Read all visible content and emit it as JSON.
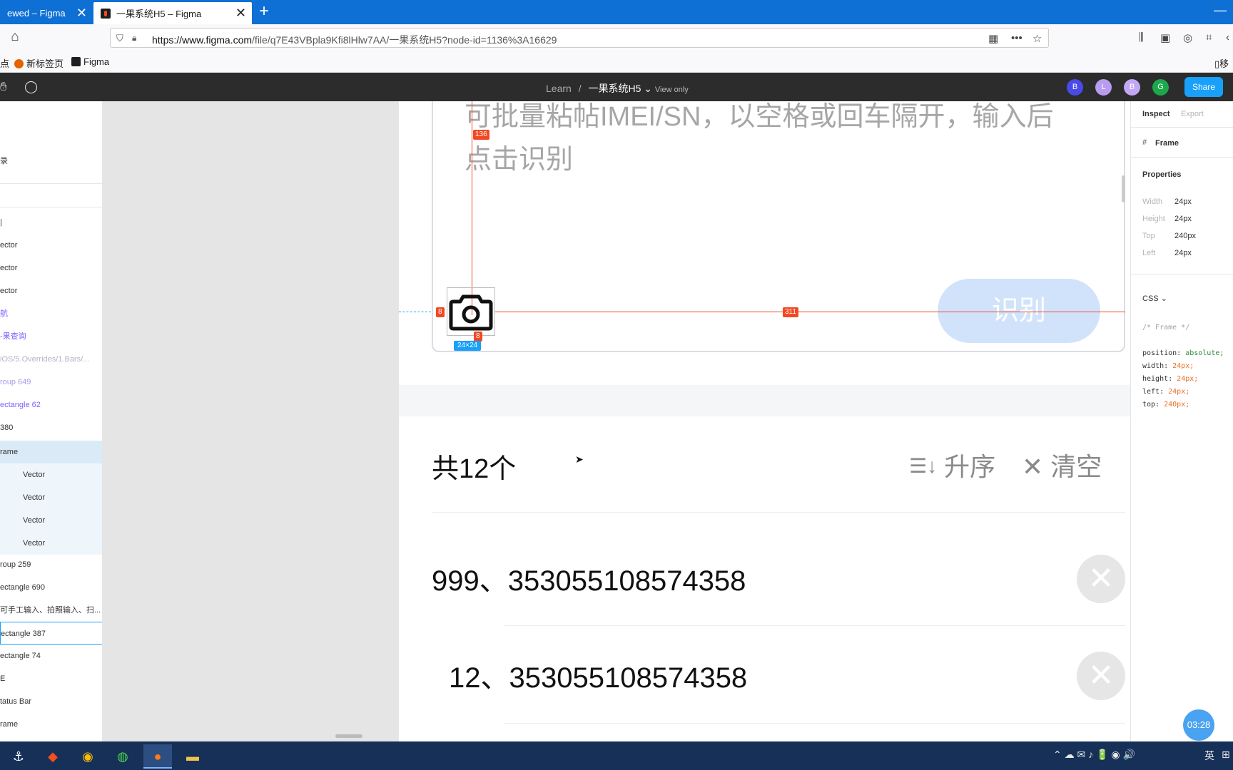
{
  "browser": {
    "tab_inactive": "ewed – Figma",
    "tab_active": "一果系统H5 – Figma",
    "tab_close": "✕",
    "new_tab": "+",
    "minimize": "—",
    "url_host": "https://www.figma.com",
    "url_path": "/file/q7E43VBpla9Kfi8lHlw7AA/一果系统H5?node-id=1136%3A16629",
    "bookmarks": [
      "点",
      "新标签页",
      "Figma"
    ],
    "bookmarks_right": "移"
  },
  "figma": {
    "breadcrumb_team": "Learn",
    "breadcrumb_sep": "/",
    "project_name": "一果系统H5",
    "project_chevron": "⌄",
    "view_only": "View only",
    "avatars": [
      {
        "letter": "B",
        "color": "#4a4ae8"
      },
      {
        "letter": "L",
        "color": "#b79cf0"
      },
      {
        "letter": "B",
        "color": "#c2a7f5"
      },
      {
        "letter": "G",
        "color": "#1ba94c"
      }
    ],
    "share_label": "Share"
  },
  "layers": [
    {
      "label": "录"
    },
    {
      "label": "|"
    },
    {
      "label": "ector"
    },
    {
      "label": "ector"
    },
    {
      "label": "ector"
    },
    {
      "label": "航"
    },
    {
      "label": "-果查询"
    },
    {
      "label": "iOS/5.Overrides/1.Bars/..."
    },
    {
      "label": "roup 649"
    },
    {
      "label": "ectangle 62"
    },
    {
      "label": " 380"
    },
    {
      "label": "rame"
    },
    {
      "label": "Vector"
    },
    {
      "label": "Vector"
    },
    {
      "label": "Vector"
    },
    {
      "label": "Vector"
    },
    {
      "label": "roup 259"
    },
    {
      "label": "ectangle 690"
    },
    {
      "label": "可手工输入、拍照输入、扫..."
    },
    {
      "label": "ectangle 387"
    },
    {
      "label": "ectangle 74"
    },
    {
      "label": "E"
    },
    {
      "label": "tatus Bar"
    },
    {
      "label": "rame"
    }
  ],
  "canvas": {
    "placeholder_line1": "可批量粘帖IMEI/SN，以空格或回车隔开，输入后",
    "placeholder_line2": "点击识别",
    "identify_button": "识别",
    "badges": {
      "top": "136",
      "left": "8",
      "bottom": "8",
      "right": "311"
    },
    "dim_label": "24×24",
    "count_label": "共12个",
    "sort_label": "升序",
    "sort_icon": "☰↓",
    "clear_label": "清空",
    "clear_icon": "✕",
    "items": [
      {
        "text": "999、353055108574358"
      },
      {
        "text": "12、353055108574358"
      }
    ],
    "delete_icon": "✕"
  },
  "inspect": {
    "tab_inspect": "Inspect",
    "tab_export": "Export",
    "frame_label": "Frame",
    "properties_title": "Properties",
    "props": [
      {
        "name": "Width",
        "value": "24px"
      },
      {
        "name": "Height",
        "value": "24px"
      },
      {
        "name": "Top",
        "value": "240px"
      },
      {
        "name": "Left",
        "value": "24px"
      }
    ],
    "css_dropdown": "CSS ⌄",
    "css_comment": "/* Frame */",
    "css_lines": [
      {
        "prop": "position:",
        "val": " absolute;"
      },
      {
        "prop": "width:",
        "val": " 24px;"
      },
      {
        "prop": "height:",
        "val": " 24px;"
      },
      {
        "prop": "left:",
        "val": " 24px;"
      },
      {
        "prop": "top:",
        "val": " 240px;"
      }
    ],
    "timer": "03:28"
  },
  "taskbar": {
    "ime": "英",
    "tray_icons": "⌃  ☁  ✉  ♪  🔋  ◉  🔊"
  }
}
